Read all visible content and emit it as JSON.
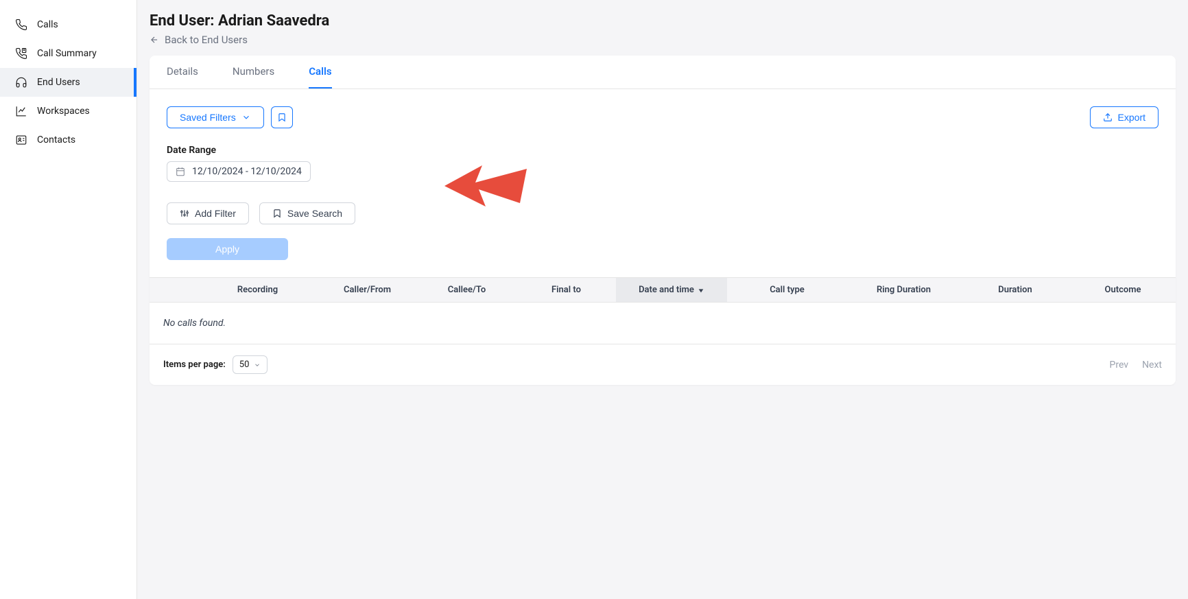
{
  "sidebar": {
    "items": [
      {
        "label": "Calls",
        "icon": "phone"
      },
      {
        "label": "Call Summary",
        "icon": "summary"
      },
      {
        "label": "End Users",
        "icon": "headphones"
      },
      {
        "label": "Workspaces",
        "icon": "workspaces"
      },
      {
        "label": "Contacts",
        "icon": "contacts"
      }
    ]
  },
  "header": {
    "title": "End User: Adrian Saavedra",
    "back_label": "Back to End Users"
  },
  "tabs": [
    {
      "label": "Details"
    },
    {
      "label": "Numbers"
    },
    {
      "label": "Calls"
    }
  ],
  "filters": {
    "saved_filters_label": "Saved Filters",
    "export_label": "Export",
    "date_range_label": "Date Range",
    "date_range_value": "12/10/2024 - 12/10/2024",
    "add_filter_label": "Add Filter",
    "save_search_label": "Save Search",
    "apply_label": "Apply"
  },
  "table": {
    "columns": [
      "Recording",
      "Caller/From",
      "Callee/To",
      "Final to",
      "Date and time",
      "Call type",
      "Ring Duration",
      "Duration",
      "Outcome"
    ],
    "empty_message": "No calls found."
  },
  "pagination": {
    "items_per_page_label": "Items per page:",
    "page_size": "50",
    "prev_label": "Prev",
    "next_label": "Next"
  }
}
